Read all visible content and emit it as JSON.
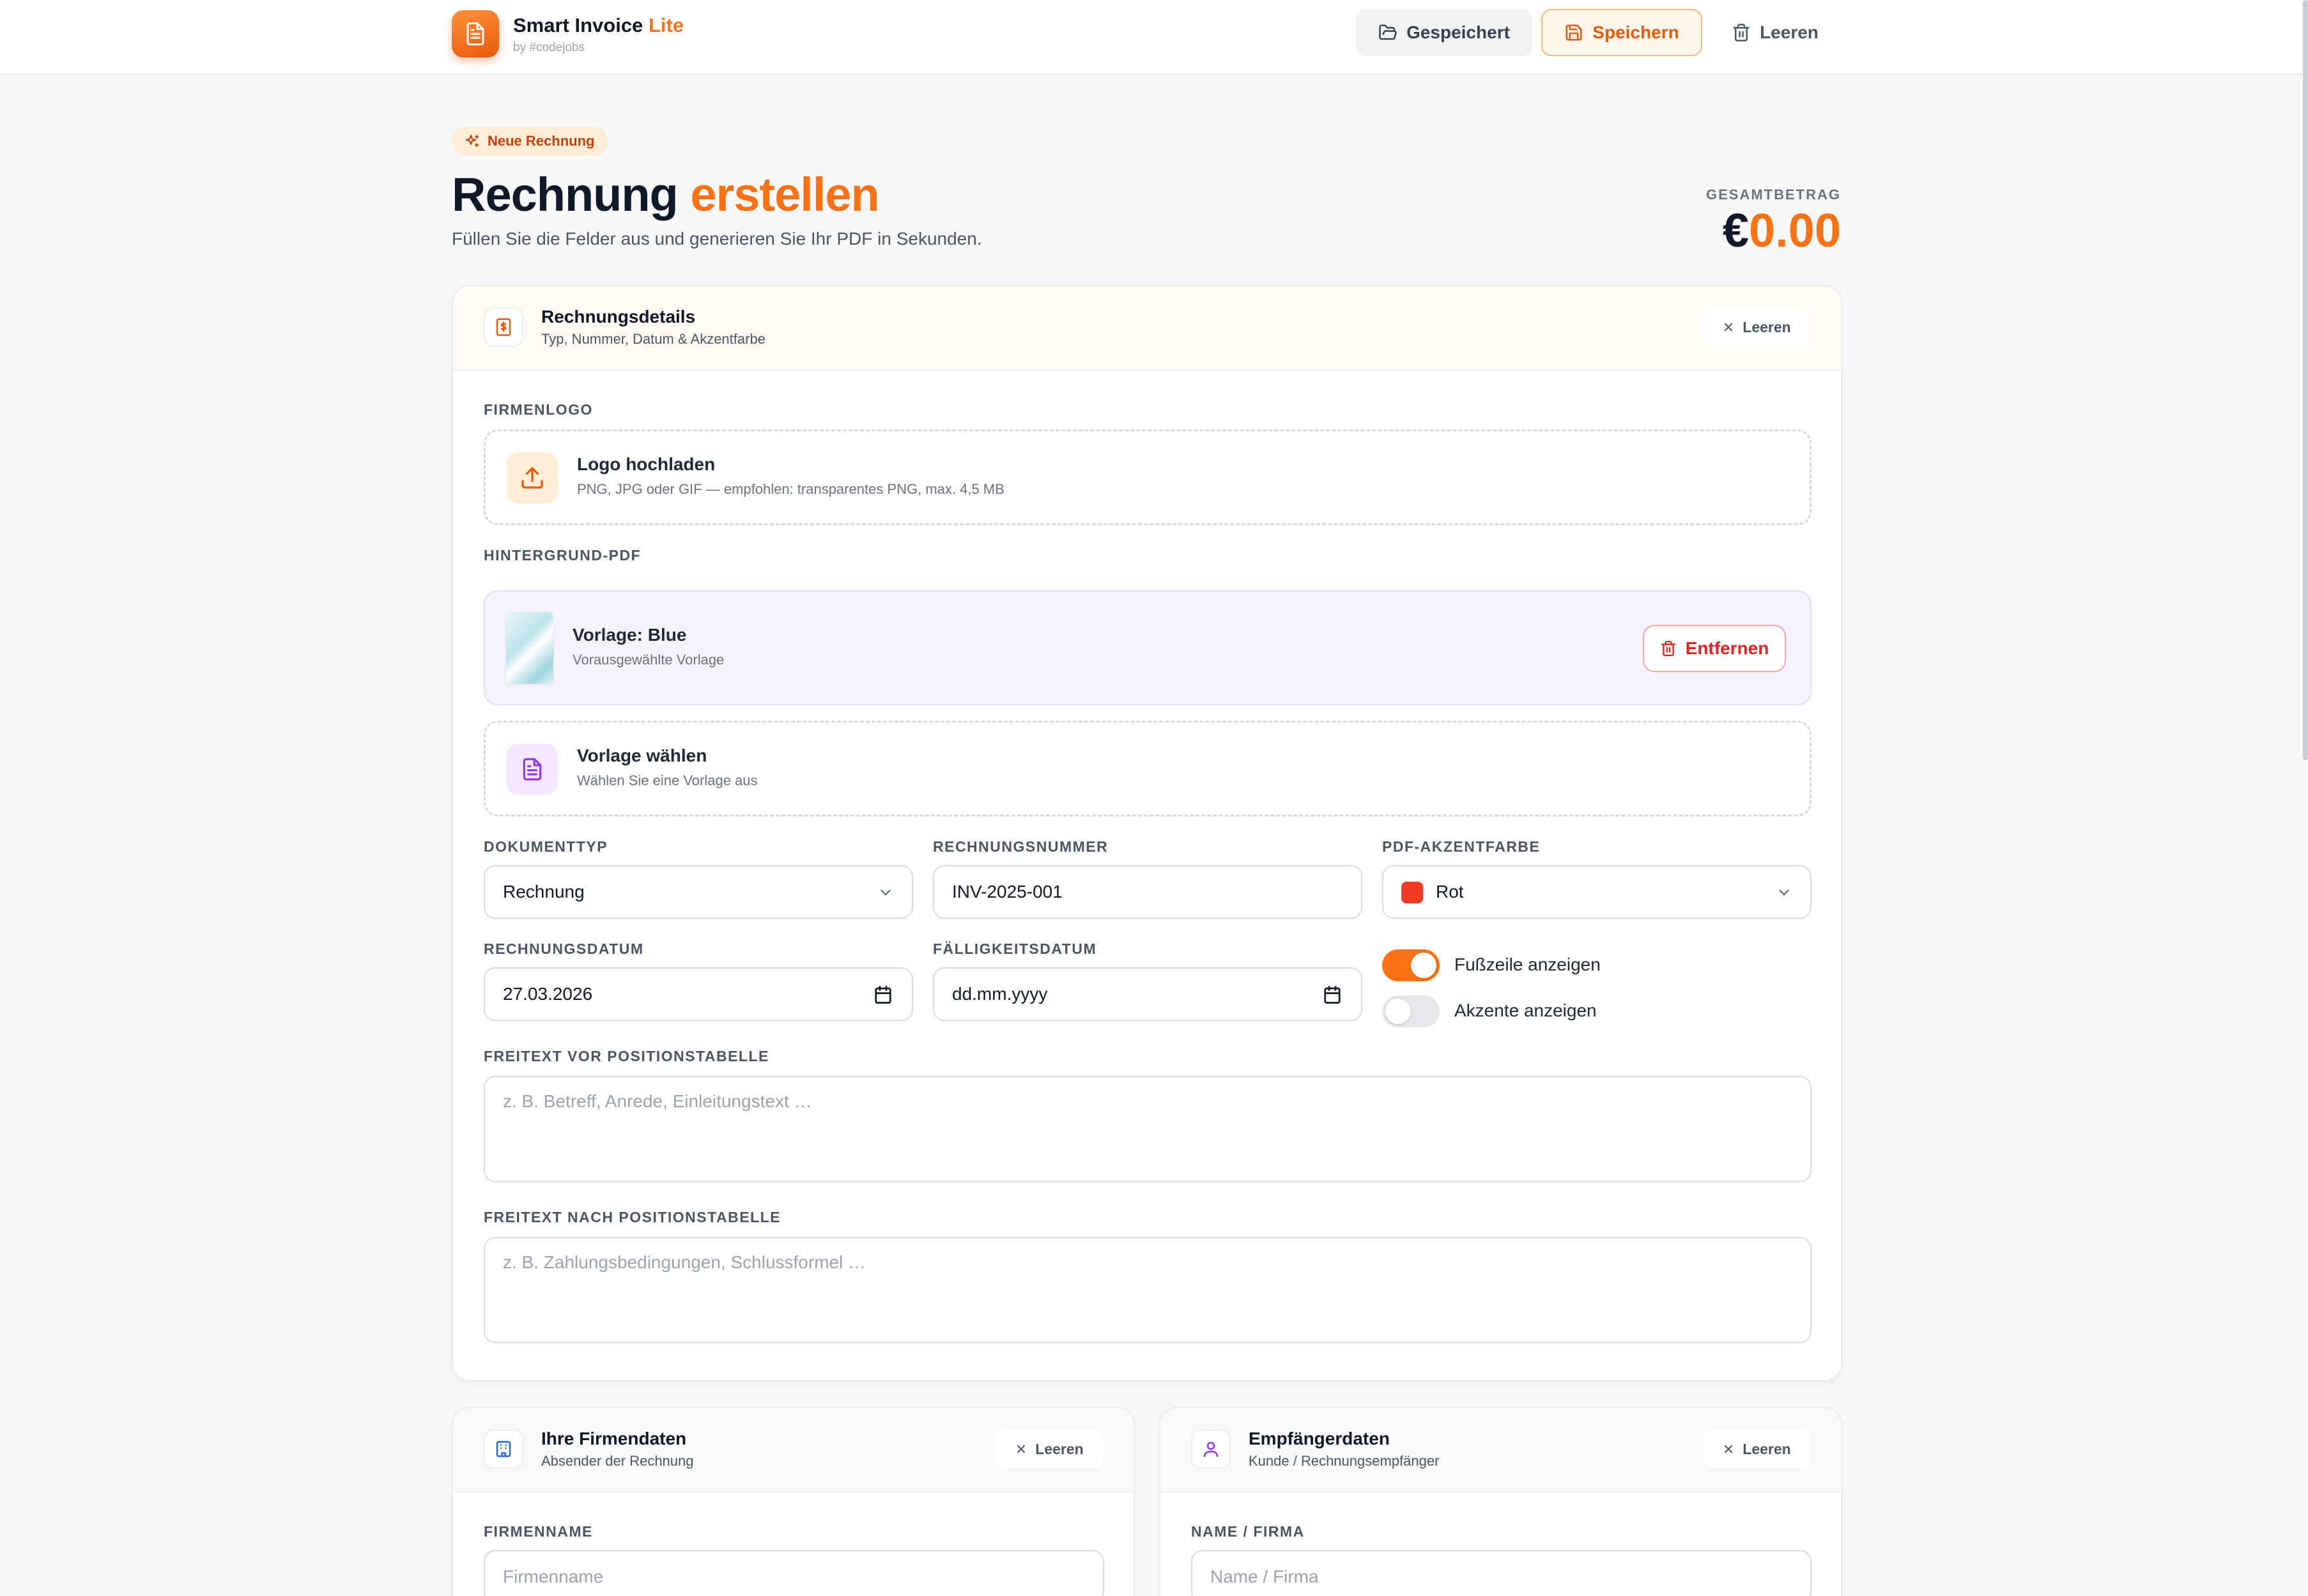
{
  "app": {
    "name": "Smart Invoice",
    "name_accent": "Lite",
    "byline": "by #codejobs"
  },
  "toolbar": {
    "saved_label": "Gespeichert",
    "save_label": "Speichern",
    "clear_label": "Leeren"
  },
  "header": {
    "badge": "Neue Rechnung",
    "title": "Rechnung",
    "title_accent": "erstellen",
    "subtitle": "Füllen Sie die Felder aus und generieren Sie Ihr PDF in Sekunden.",
    "total_label": "GESAMTBETRAG",
    "total_currency": "€",
    "total_value": "0.00"
  },
  "details": {
    "title": "Rechnungsdetails",
    "subtitle": "Typ, Nummer, Datum & Akzentfarbe",
    "clear_label": "Leeren",
    "logo_label": "FIRMENLOGO",
    "logo_upload_title": "Logo hochladen",
    "logo_upload_hint": "PNG, JPG oder GIF — empfohlen: transparentes PNG, max. 4,5 MB",
    "bg_label": "HINTERGRUND-PDF",
    "template_title": "Vorlage: Blue",
    "template_sub": "Vorausgewählte Vorlage",
    "remove_label": "Entfernen",
    "choose_title": "Vorlage wählen",
    "choose_sub": "Wählen Sie eine Vorlage aus",
    "doctype_label": "DOKUMENTTYP",
    "doctype_value": "Rechnung",
    "number_label": "RECHNUNGSNUMMER",
    "number_value": "INV-2025-001",
    "accent_label": "PDF-AKZENTFARBE",
    "accent_value": "Rot",
    "accent_color": "#f03c25",
    "date_label": "RECHNUNGSDATUM",
    "date_value": "27.03.2026",
    "due_label": "FÄLLIGKEITSDATUM",
    "due_placeholder": "dd.mm.yyyy",
    "footer_toggle_label": "Fußzeile anzeigen",
    "footer_toggle_on": true,
    "accents_toggle_label": "Akzente anzeigen",
    "accents_toggle_on": false,
    "pre_text_label": "FREITEXT VOR POSITIONSTABELLE",
    "pre_text_placeholder": "z. B. Betreff, Anrede, Einleitungstext …",
    "post_text_label": "FREITEXT NACH POSITIONSTABELLE",
    "post_text_placeholder": "z. B. Zahlungsbedingungen, Schlussformel …"
  },
  "company": {
    "title": "Ihre Firmendaten",
    "subtitle": "Absender der Rechnung",
    "clear_label": "Leeren",
    "name_label": "FIRMENNAME",
    "name_placeholder": "Firmenname"
  },
  "recipient": {
    "title": "Empfängerdaten",
    "subtitle": "Kunde / Rechnungsempfänger",
    "clear_label": "Leeren",
    "name_label": "NAME / FIRMA",
    "name_placeholder": "Name / Firma"
  },
  "colors": {
    "accent": "#f97316",
    "danger": "#dc2626",
    "purple": "#9333ea"
  }
}
